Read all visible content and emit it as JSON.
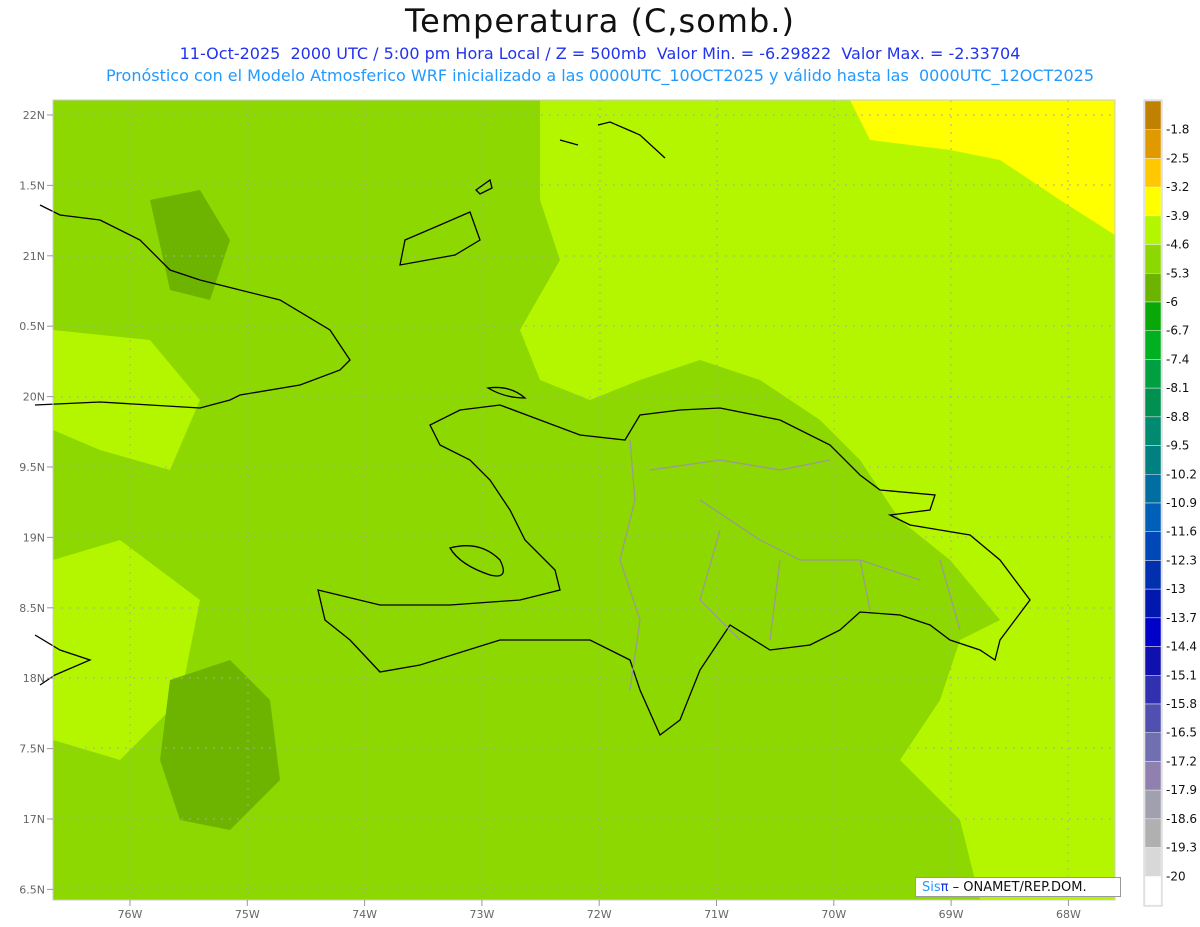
{
  "title": "Temperatura (C,somb.)",
  "subtitle_line1": "11-Oct-2025  2000 UTC / 5:00 pm Hora Local / Z = 500mb  Valor Min. = -6.29822  Valor Max. = -2.33704",
  "subtitle_line2": "Pronóstico con el Modelo Atmosferico WRF inicializado a las 0000UTC_10OCT2025 y válido hasta las  0000UTC_12OCT2025",
  "lat_labels": [
    "22N",
    "1.5N",
    "21N",
    "0.5N",
    "20N",
    "9.5N",
    "19N",
    "8.5N",
    "18N",
    "7.5N",
    "17N",
    "6.5N"
  ],
  "lon_labels": [
    "76W",
    "75W",
    "74W",
    "73W",
    "72W",
    "71W",
    "70W",
    "69W",
    "68W"
  ],
  "colorbar": {
    "labels": [
      "-1.8",
      "-2.5",
      "-3.2",
      "-3.9",
      "-4.6",
      "-5.3",
      "-6",
      "-6.7",
      "-7.4",
      "-8.1",
      "-8.8",
      "-9.5",
      "-10.2",
      "-10.9",
      "-11.6",
      "-12.3",
      "-13",
      "-13.7",
      "-14.4",
      "-15.1",
      "-15.8",
      "-16.5",
      "-17.2",
      "-17.9",
      "-18.6",
      "-19.3",
      "-20"
    ],
    "colors": [
      "#c08000",
      "#e09a00",
      "#ffc800",
      "#ffff00",
      "#b4f500",
      "#8cd800",
      "#6db400",
      "#08a808",
      "#00b020",
      "#00a040",
      "#009050",
      "#008a70",
      "#008080",
      "#006ea0",
      "#0060b8",
      "#0048b8",
      "#0030b0",
      "#0018b0",
      "#0000c8",
      "#1010b0",
      "#3030b0",
      "#5050b0",
      "#7070b0",
      "#9080b0",
      "#a0a0b0",
      "#b0b0b0",
      "#d8d8d8",
      "#ffffff"
    ]
  },
  "credit": {
    "brand": "Sis",
    "pi": "π",
    "text": " –  ONAMET/REP.DOM."
  }
}
